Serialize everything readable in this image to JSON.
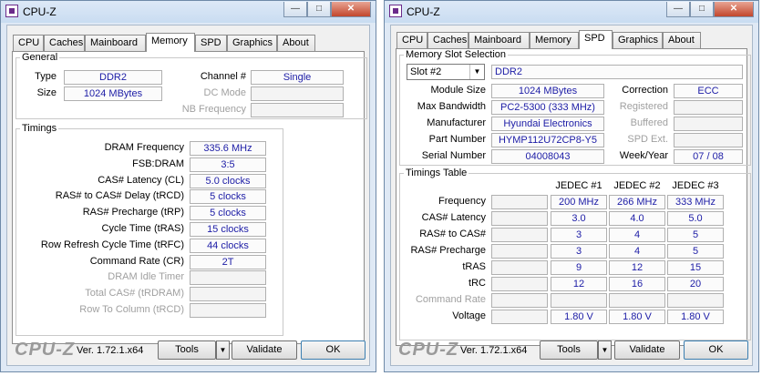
{
  "windows": [
    {
      "title": "CPU-Z",
      "controls": {
        "minimize": "—",
        "maximize": "□",
        "close": "✕"
      },
      "tabs": [
        "CPU",
        "Caches",
        "Mainboard",
        "Memory",
        "SPD",
        "Graphics",
        "About"
      ],
      "active_tab": "Memory",
      "general": {
        "legend": "General",
        "type_label": "Type",
        "type_value": "DDR2",
        "size_label": "Size",
        "size_value": "1024 MBytes",
        "channel_label": "Channel #",
        "channel_value": "Single",
        "dc_mode_label": "DC Mode",
        "dc_mode_value": "",
        "nb_freq_label": "NB Frequency",
        "nb_freq_value": ""
      },
      "timings": {
        "legend": "Timings",
        "rows": [
          {
            "label": "DRAM Frequency",
            "value": "335.6 MHz",
            "disabled": false
          },
          {
            "label": "FSB:DRAM",
            "value": "3:5",
            "disabled": false
          },
          {
            "label": "CAS# Latency (CL)",
            "value": "5.0 clocks",
            "disabled": false
          },
          {
            "label": "RAS# to CAS# Delay (tRCD)",
            "value": "5 clocks",
            "disabled": false
          },
          {
            "label": "RAS# Precharge (tRP)",
            "value": "5 clocks",
            "disabled": false
          },
          {
            "label": "Cycle Time (tRAS)",
            "value": "15 clocks",
            "disabled": false
          },
          {
            "label": "Row Refresh Cycle Time (tRFC)",
            "value": "44 clocks",
            "disabled": false
          },
          {
            "label": "Command Rate (CR)",
            "value": "2T",
            "disabled": false
          },
          {
            "label": "DRAM Idle Timer",
            "value": "",
            "disabled": true
          },
          {
            "label": "Total CAS# (tRDRAM)",
            "value": "",
            "disabled": true
          },
          {
            "label": "Row To Column (tRCD)",
            "value": "",
            "disabled": true
          }
        ]
      },
      "footer": {
        "brand": "CPU-Z",
        "version": "Ver. 1.72.1.x64",
        "tools": "Tools",
        "validate": "Validate",
        "ok": "OK",
        "tools_arrow": "▼"
      }
    },
    {
      "title": "CPU-Z",
      "controls": {
        "minimize": "—",
        "maximize": "□",
        "close": "✕"
      },
      "tabs": [
        "CPU",
        "Caches",
        "Mainboard",
        "Memory",
        "SPD",
        "Graphics",
        "About"
      ],
      "active_tab": "SPD",
      "slot": {
        "legend": "Memory Slot Selection",
        "slot_value": "Slot #2",
        "slot_arrow": "▼",
        "type_value": "DDR2",
        "rows": [
          {
            "label": "Module Size",
            "value": "1024 MBytes",
            "label2": "Correction",
            "value2": "ECC",
            "disabled2": false
          },
          {
            "label": "Max Bandwidth",
            "value": "PC2-5300 (333 MHz)",
            "label2": "Registered",
            "value2": "",
            "disabled2": true
          },
          {
            "label": "Manufacturer",
            "value": "Hyundai Electronics",
            "label2": "Buffered",
            "value2": "",
            "disabled2": true
          },
          {
            "label": "Part Number",
            "value": "HYMP112U72CP8-Y5",
            "label2": "SPD Ext.",
            "value2": "",
            "disabled2": true
          },
          {
            "label": "Serial Number",
            "value": "04008043",
            "label2": "Week/Year",
            "value2": "07 / 08",
            "disabled2": false
          }
        ]
      },
      "timings_table": {
        "legend": "Timings Table",
        "headers": [
          "JEDEC #1",
          "JEDEC #2",
          "JEDEC #3"
        ],
        "rows": [
          {
            "label": "Frequency",
            "values": [
              "200 MHz",
              "266 MHz",
              "333 MHz"
            ],
            "disabled": false
          },
          {
            "label": "CAS# Latency",
            "values": [
              "3.0",
              "4.0",
              "5.0"
            ],
            "disabled": false
          },
          {
            "label": "RAS# to CAS#",
            "values": [
              "3",
              "4",
              "5"
            ],
            "disabled": false
          },
          {
            "label": "RAS# Precharge",
            "values": [
              "3",
              "4",
              "5"
            ],
            "disabled": false
          },
          {
            "label": "tRAS",
            "values": [
              "9",
              "12",
              "15"
            ],
            "disabled": false
          },
          {
            "label": "tRC",
            "values": [
              "12",
              "16",
              "20"
            ],
            "disabled": false
          },
          {
            "label": "Command Rate",
            "values": [
              "",
              "",
              ""
            ],
            "disabled": true
          },
          {
            "label": "Voltage",
            "values": [
              "1.80 V",
              "1.80 V",
              "1.80 V"
            ],
            "disabled": false
          }
        ]
      },
      "footer": {
        "brand": "CPU-Z",
        "version": "Ver. 1.72.1.x64",
        "tools": "Tools",
        "validate": "Validate",
        "ok": "OK",
        "tools_arrow": "▼"
      }
    }
  ]
}
